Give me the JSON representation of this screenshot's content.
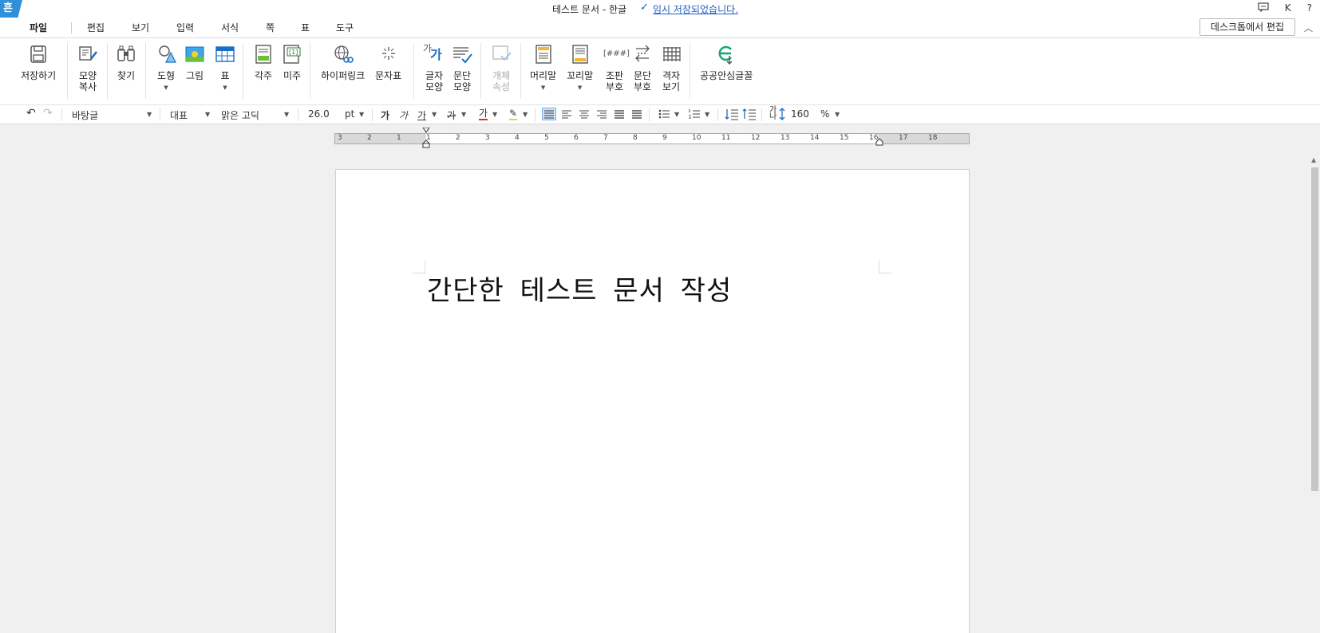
{
  "titlebar": {
    "logo": "흔",
    "title": "테스트 문서 - 한글",
    "save_status": "임시 저장되었습니다.",
    "account_initial": "K",
    "help": "?"
  },
  "menu": {
    "items": [
      "파일",
      "편집",
      "보기",
      "입력",
      "서식",
      "쪽",
      "표",
      "도구"
    ],
    "desktop_edit": "데스크톱에서 편집"
  },
  "ribbon": {
    "save": "저장하기",
    "copy_format_1": "모양",
    "copy_format_2": "복사",
    "find": "찾기",
    "shape": "도형",
    "picture": "그림",
    "table": "표",
    "footnote": "각주",
    "endnote": "미주",
    "hyperlink": "하이퍼링크",
    "symbol": "문자표",
    "char_shape_1": "글자",
    "char_shape_2": "모양",
    "para_shape_1": "문단",
    "para_shape_2": "모양",
    "obj_prop_1": "개체",
    "obj_prop_2": "속성",
    "header": "머리말",
    "footer": "꼬리말",
    "layout_mark_1": "조판",
    "layout_mark_2": "부호",
    "para_mark_1": "문단",
    "para_mark_2": "부호",
    "grid_view_1": "격자",
    "grid_view_2": "보기",
    "public_font": "공공안심글꼴",
    "icon_gaga_top": "가",
    "icon_gaga_bottom": "가",
    "icon_layout_mark": "[###]"
  },
  "format": {
    "style": "바탕글",
    "font_lang": "대표",
    "font_name": "맑은 고딕",
    "font_size": "26.0",
    "size_unit": "pt",
    "bold": "가",
    "italic": "가",
    "underline": "가",
    "strike": "가",
    "font_color": "가",
    "line_spacing_icon": "가나",
    "line_spacing": "160",
    "line_spacing_unit": "%"
  },
  "ruler": {
    "labels": [
      "3",
      "2",
      "1",
      "1",
      "2",
      "3",
      "4",
      "5",
      "6",
      "7",
      "8",
      "9",
      "10",
      "11",
      "12",
      "13",
      "14",
      "15",
      "16",
      "17",
      "18"
    ]
  },
  "document": {
    "text": "간단한 테스트 문서 작성"
  },
  "colors": {
    "accent": "#2f8fd8",
    "link": "#1f5fbf",
    "text_color_underline": "#d32f2f",
    "highlight": "#f2d22c"
  }
}
